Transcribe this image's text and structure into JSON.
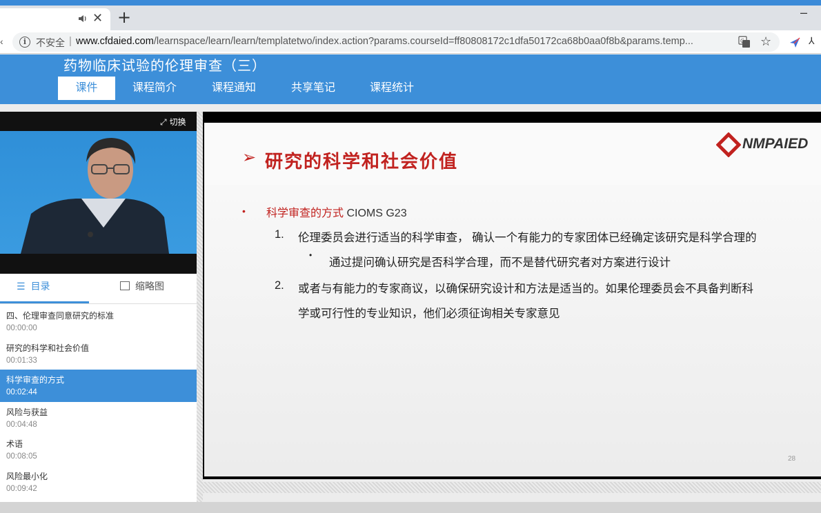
{
  "browser": {
    "tab": {
      "audio_icon": "speaker-icon",
      "close": "✕"
    },
    "new_tab": "+",
    "minimize": "–",
    "address": {
      "security_label": "不安全",
      "separator": "|",
      "url_host": "www.cfdaied.com",
      "url_path": "/learnspace/learn/learn/templatetwo/index.action?params.courseId=ff80808172c1dfa50172ca68b0aa0f8b&params.temp..."
    }
  },
  "site": {
    "course_title": "药物临床试验的伦理审查（三）",
    "nav_tabs": [
      {
        "label": "课件",
        "active": true
      },
      {
        "label": "课程简介",
        "active": false
      },
      {
        "label": "课程通知",
        "active": false
      },
      {
        "label": "共享笔记",
        "active": false
      },
      {
        "label": "课程统计",
        "active": false
      }
    ]
  },
  "sidebar": {
    "switch_label": "切换",
    "tabs": [
      {
        "label": "目录",
        "icon": "list-icon",
        "active": true
      },
      {
        "label": "缩略图",
        "icon": "image-icon",
        "active": false
      }
    ],
    "toc": [
      {
        "title": "四、伦理审查同意研究的标准",
        "time": "00:00:00",
        "active": false
      },
      {
        "title": "研究的科学和社会价值",
        "time": "00:01:33",
        "active": false
      },
      {
        "title": "科学审查的方式",
        "time": "00:02:44",
        "active": true
      },
      {
        "title": "风险与获益",
        "time": "00:04:48",
        "active": false
      },
      {
        "title": "术语",
        "time": "00:08:05",
        "active": false
      },
      {
        "title": "风险最小化",
        "time": "00:09:42",
        "active": false
      }
    ]
  },
  "slide": {
    "arrow": "➢",
    "title": "研究的科学和社会价值",
    "logo_text": "NMPAIED",
    "bullet": "•",
    "heading_cn": "科学审查的方式",
    "heading_en": " CIOMS G23",
    "item1_num": "1.",
    "item1_text": "伦理委员会进行适当的科学审查， 确认一个有能力的专家团体已经确定该研究是科学合理的",
    "sub_bullet": "•",
    "sub_text": "通过提问确认研究是否科学合理，而不是替代研究者对方案进行设计",
    "item2_num": "2.",
    "item2_line1": "或者与有能力的专家商议，以确保研究设计和方法是适当的。如果伦理委员会不具备判断科",
    "item2_line2": "学或可行性的专业知识，他们必须征询相关专家意见",
    "page_number": "28"
  },
  "colors": {
    "brand_blue": "#3d8fd9",
    "slide_red": "#c1221f"
  }
}
